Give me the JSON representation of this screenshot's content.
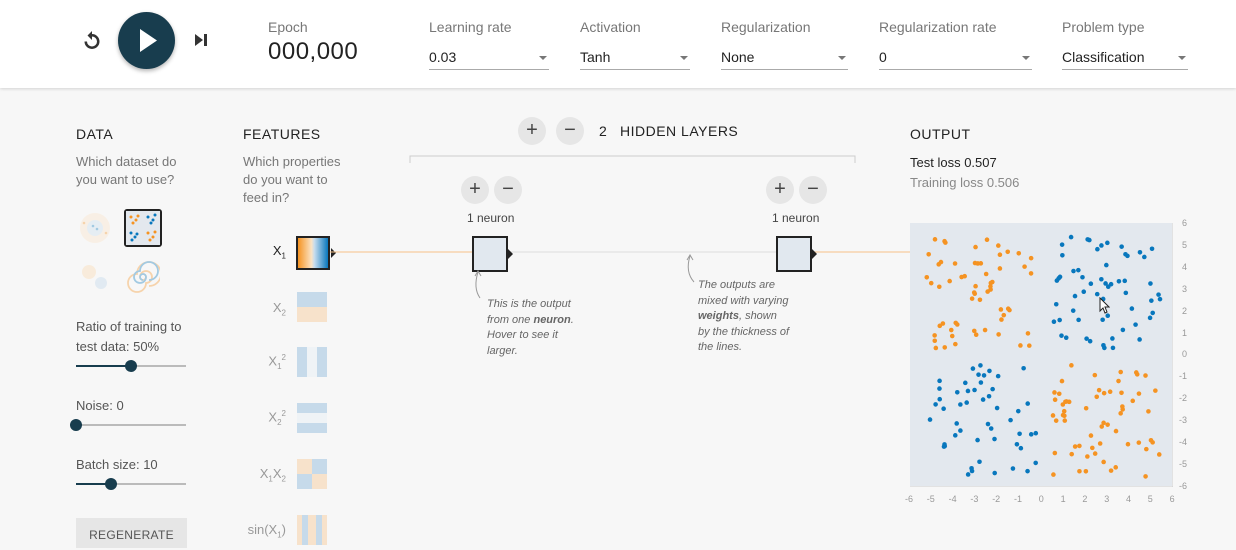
{
  "controls": {
    "reset_icon": "reset-icon",
    "play_icon": "play-icon",
    "step_icon": "step-forward-icon"
  },
  "epoch": {
    "label": "Epoch",
    "value": "000,000"
  },
  "learning_rate": {
    "label": "Learning rate",
    "value": "0.03"
  },
  "activation": {
    "label": "Activation",
    "value": "Tanh"
  },
  "regularization": {
    "label": "Regularization",
    "value": "None"
  },
  "regularization_rate": {
    "label": "Regularization rate",
    "value": "0"
  },
  "problem_type": {
    "label": "Problem type",
    "value": "Classification"
  },
  "data": {
    "title": "DATA",
    "desc1": "Which dataset do",
    "desc2": "you want to use?",
    "ratio_label1": "Ratio of training to",
    "ratio_label2": "test data:  50%",
    "ratio_value": 0.5,
    "noise_label": "Noise:  0",
    "noise_value": 0,
    "batch_label": "Batch size:  10",
    "batch_value": 0.32,
    "regenerate": "REGENERATE"
  },
  "features": {
    "title": "FEATURES",
    "desc1": "Which properties",
    "desc2": "do you want to",
    "desc3": "feed in?",
    "items": [
      {
        "label": "X1"
      },
      {
        "label": "X2"
      },
      {
        "label": "X1²"
      },
      {
        "label": "X2²"
      },
      {
        "label": "X1X2"
      },
      {
        "label": "sin(X1)"
      }
    ]
  },
  "network": {
    "add_icon": "plus-icon",
    "remove_icon": "minus-icon",
    "count": "2",
    "hidden_layers_label": "HIDDEN LAYERS",
    "layer1_neurons": "1 neuron",
    "layer2_neurons": "1 neuron",
    "annotation1": [
      "This is the output",
      "from one neuron.",
      "Hover to see it",
      "larger."
    ],
    "annotation2": [
      "The outputs are",
      "mixed with varying",
      "weights, shown",
      "by the thickness of",
      "the lines."
    ]
  },
  "output": {
    "title": "OUTPUT",
    "test_loss_label": "Test loss",
    "test_loss_value": "0.507",
    "training_loss_label": "Training loss",
    "training_loss_value": "0.506",
    "x_ticks": [
      "-6",
      "-5",
      "-4",
      "-3",
      "-2",
      "-1",
      "0",
      "1",
      "2",
      "3",
      "4",
      "5",
      "6"
    ],
    "y_ticks": [
      "6",
      "5",
      "4",
      "3",
      "2",
      "1",
      "0",
      "-1",
      "-2",
      "-3",
      "-4",
      "-5",
      "-6"
    ]
  },
  "colors": {
    "accent": "#183d4e",
    "orange": "#f59322",
    "blue": "#0877bd",
    "plot_bg": "#e3e8ee"
  }
}
